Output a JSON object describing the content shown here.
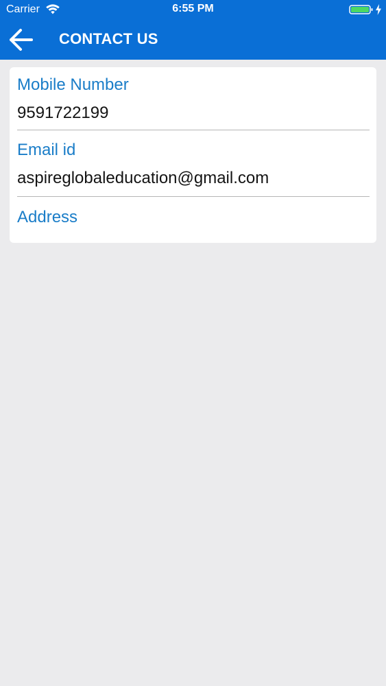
{
  "status_bar": {
    "carrier": "Carrier",
    "time": "6:55 PM",
    "battery_color": "#4cd964"
  },
  "header": {
    "title": "CONTACT US",
    "background_color": "#0a6fd6"
  },
  "contact": {
    "mobile": {
      "label": "Mobile Number",
      "value": "9591722199"
    },
    "email": {
      "label": "Email id",
      "value": "aspireglobaleducation@gmail.com"
    },
    "address": {
      "label": "Address"
    }
  },
  "colors": {
    "label": "#1a7dc8",
    "background": "#ebebed"
  }
}
